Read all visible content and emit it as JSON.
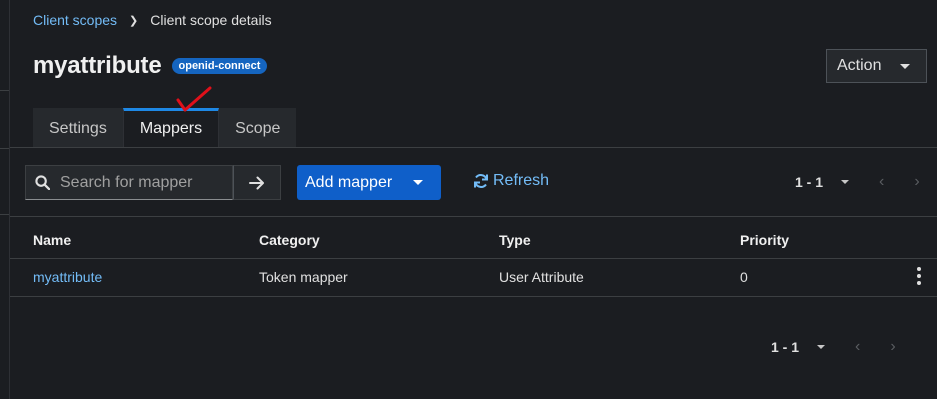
{
  "breadcrumb": {
    "parent": "Client scopes",
    "current": "Client scope details"
  },
  "header": {
    "title": "myattribute",
    "badge": "openid-connect",
    "action_label": "Action"
  },
  "tabs": [
    {
      "label": "Settings",
      "active": false
    },
    {
      "label": "Mappers",
      "active": true
    },
    {
      "label": "Scope",
      "active": false
    }
  ],
  "toolbar": {
    "search_placeholder": "Search for mapper",
    "add_label": "Add mapper",
    "refresh_label": "Refresh",
    "pagination": "1 - 1"
  },
  "table": {
    "columns": [
      "Name",
      "Category",
      "Type",
      "Priority"
    ],
    "rows": [
      {
        "name": "myattribute",
        "category": "Token mapper",
        "type": "User Attribute",
        "priority": "0"
      }
    ]
  },
  "footer": {
    "pagination": "1 - 1"
  },
  "colors": {
    "accent": "#1e88e5",
    "link": "#73bcf7",
    "primary_button": "#0f5fc9",
    "annotation": "#e0101a"
  },
  "annotation": {
    "icon": "red-checkmark-icon"
  }
}
